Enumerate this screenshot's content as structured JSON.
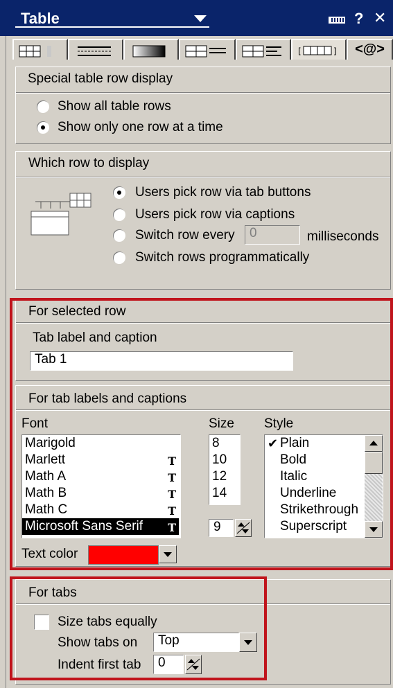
{
  "window": {
    "title": "Table"
  },
  "special_row_display": {
    "heading": "Special table row display",
    "options": [
      "Show all table rows",
      "Show only one row at a time"
    ],
    "selected_index": 1
  },
  "which_row": {
    "heading": "Which row to display",
    "options": [
      "Users pick row via tab buttons",
      "Users pick row via captions",
      "Switch row every",
      "Switch rows programmatically"
    ],
    "selected_index": 0,
    "interval_value": "0",
    "interval_unit": "milliseconds"
  },
  "selected_row": {
    "heading": "For selected row",
    "tab_label_caption_label": "Tab label and caption",
    "tab_label_value": "Tab 1"
  },
  "tab_labels": {
    "heading": "For tab labels and captions",
    "font_label": "Font",
    "size_label": "Size",
    "style_label": "Style",
    "fonts": [
      "Marigold",
      "Marlett",
      "Math A",
      "Math B",
      "Math C",
      "Microsoft Sans Serif"
    ],
    "selected_font": "Microsoft Sans Serif",
    "sizes": [
      "8",
      "10",
      "12",
      "14"
    ],
    "size_value": "9",
    "styles": [
      "Plain",
      "Bold",
      "Italic",
      "Underline",
      "Strikethrough",
      "Superscript"
    ],
    "checked_style": "Plain",
    "text_color_label": "Text color",
    "text_color": "#ff0000",
    "truetype_glyph": "T"
  },
  "for_tabs": {
    "heading": "For tabs",
    "size_equally_label": "Size tabs equally",
    "show_tabs_on_label": "Show tabs on",
    "show_tabs_on_value": "Top",
    "indent_label": "Indent first tab",
    "indent_value": "0"
  },
  "tabs": {
    "code_tab_label": "<@>",
    "code_tab_text": "<@>"
  },
  "colors": {
    "titlebar": "#0a246a",
    "highlight_box": "#c0141c",
    "panel": "#d4d0c8"
  }
}
